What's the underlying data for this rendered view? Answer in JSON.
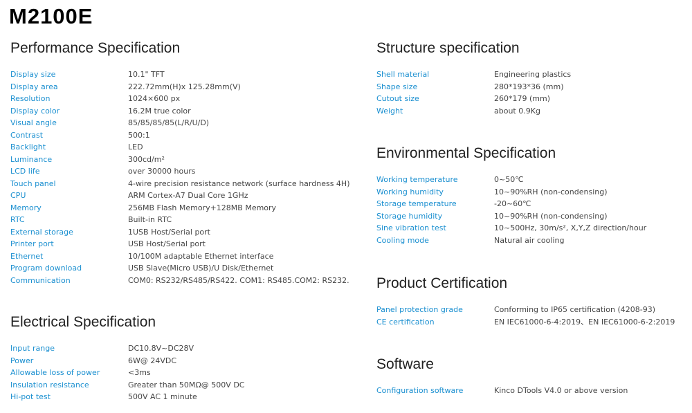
{
  "title": "M2100E",
  "sections": {
    "performance": {
      "heading": "Performance Specification",
      "rows": [
        {
          "k": "Display size",
          "v": "10.1\" TFT"
        },
        {
          "k": "Display area",
          "v": "222.72mm(H)x 125.28mm(V)"
        },
        {
          "k": "Resolution",
          "v": "1024×600 px"
        },
        {
          "k": "Display color",
          "v": "16.2M true color"
        },
        {
          "k": "Visual angle",
          "v": "85/85/85/85(L/R/U/D)"
        },
        {
          "k": "Contrast",
          "v": "500:1"
        },
        {
          "k": "Backlight",
          "v": "LED"
        },
        {
          "k": "Luminance",
          "v": "300cd/m²"
        },
        {
          "k": "LCD life",
          "v": "over 30000 hours"
        },
        {
          "k": "Touch panel",
          "v": "4-wire precision resistance network (surface hardness 4H)"
        },
        {
          "k": "CPU",
          "v": "ARM Cortex-A7 Dual Core 1GHz"
        },
        {
          "k": "Memory",
          "v": "256MB Flash Memory+128MB Memory"
        },
        {
          "k": "RTC",
          "v": "Built-in RTC"
        },
        {
          "k": "External storage",
          "v": "1USB Host/Serial port"
        },
        {
          "k": "Printer port",
          "v": "USB Host/Serial port"
        },
        {
          "k": "Ethernet",
          "v": "10/100M adaptable Ethernet interface"
        },
        {
          "k": "Program download",
          "v": "USB Slave(Micro USB)/U Disk/Ethernet"
        },
        {
          "k": "Communication",
          "v": "COM0: RS232/RS485/RS422. COM1: RS485.COM2: RS232."
        }
      ]
    },
    "electrical": {
      "heading": "Electrical Specification",
      "rows": [
        {
          "k": "Input range",
          "v": "DC10.8V~DC28V"
        },
        {
          "k": "Power",
          "v": "6W@ 24VDC"
        },
        {
          "k": "Allowable loss of power",
          "v": "<3ms"
        },
        {
          "k": "Insulation resistance",
          "v": "Greater than 50MΩ@ 500V DC"
        },
        {
          "k": "Hi-pot test",
          "v": "500V AC 1 minute"
        }
      ]
    },
    "structure": {
      "heading": "Structure specification",
      "rows": [
        {
          "k": "Shell material",
          "v": "Engineering plastics"
        },
        {
          "k": "Shape size",
          "v": "280*193*36 (mm)"
        },
        {
          "k": "Cutout size",
          "v": "260*179 (mm)"
        },
        {
          "k": "Weight",
          "v": "about 0.9Kg"
        }
      ]
    },
    "environmental": {
      "heading": "Environmental Specification",
      "rows": [
        {
          "k": "Working temperature",
          "v": "0~50℃"
        },
        {
          "k": "Working humidity",
          "v": "10~90%RH (non-condensing)"
        },
        {
          "k": "Storage temperature",
          "v": "-20~60℃"
        },
        {
          "k": "Storage humidity",
          "v": "10~90%RH (non-condensing)"
        },
        {
          "k": "Sine vibration test",
          "v": "10~500Hz, 30m/s², X,Y,Z direction/hour"
        },
        {
          "k": "Cooling mode",
          "v": "Natural air cooling"
        }
      ]
    },
    "certification": {
      "heading": "Product Certification",
      "rows": [
        {
          "k": "Panel protection grade",
          "v": "Conforming to IP65 certification (4208-93)"
        },
        {
          "k": "CE certification",
          "v": "EN IEC61000-6-4:2019、EN IEC61000-6-2:2019"
        }
      ]
    },
    "software": {
      "heading": "Software",
      "rows": [
        {
          "k": "Configuration software",
          "v": "Kinco DTools V4.0 or above version"
        }
      ]
    }
  }
}
